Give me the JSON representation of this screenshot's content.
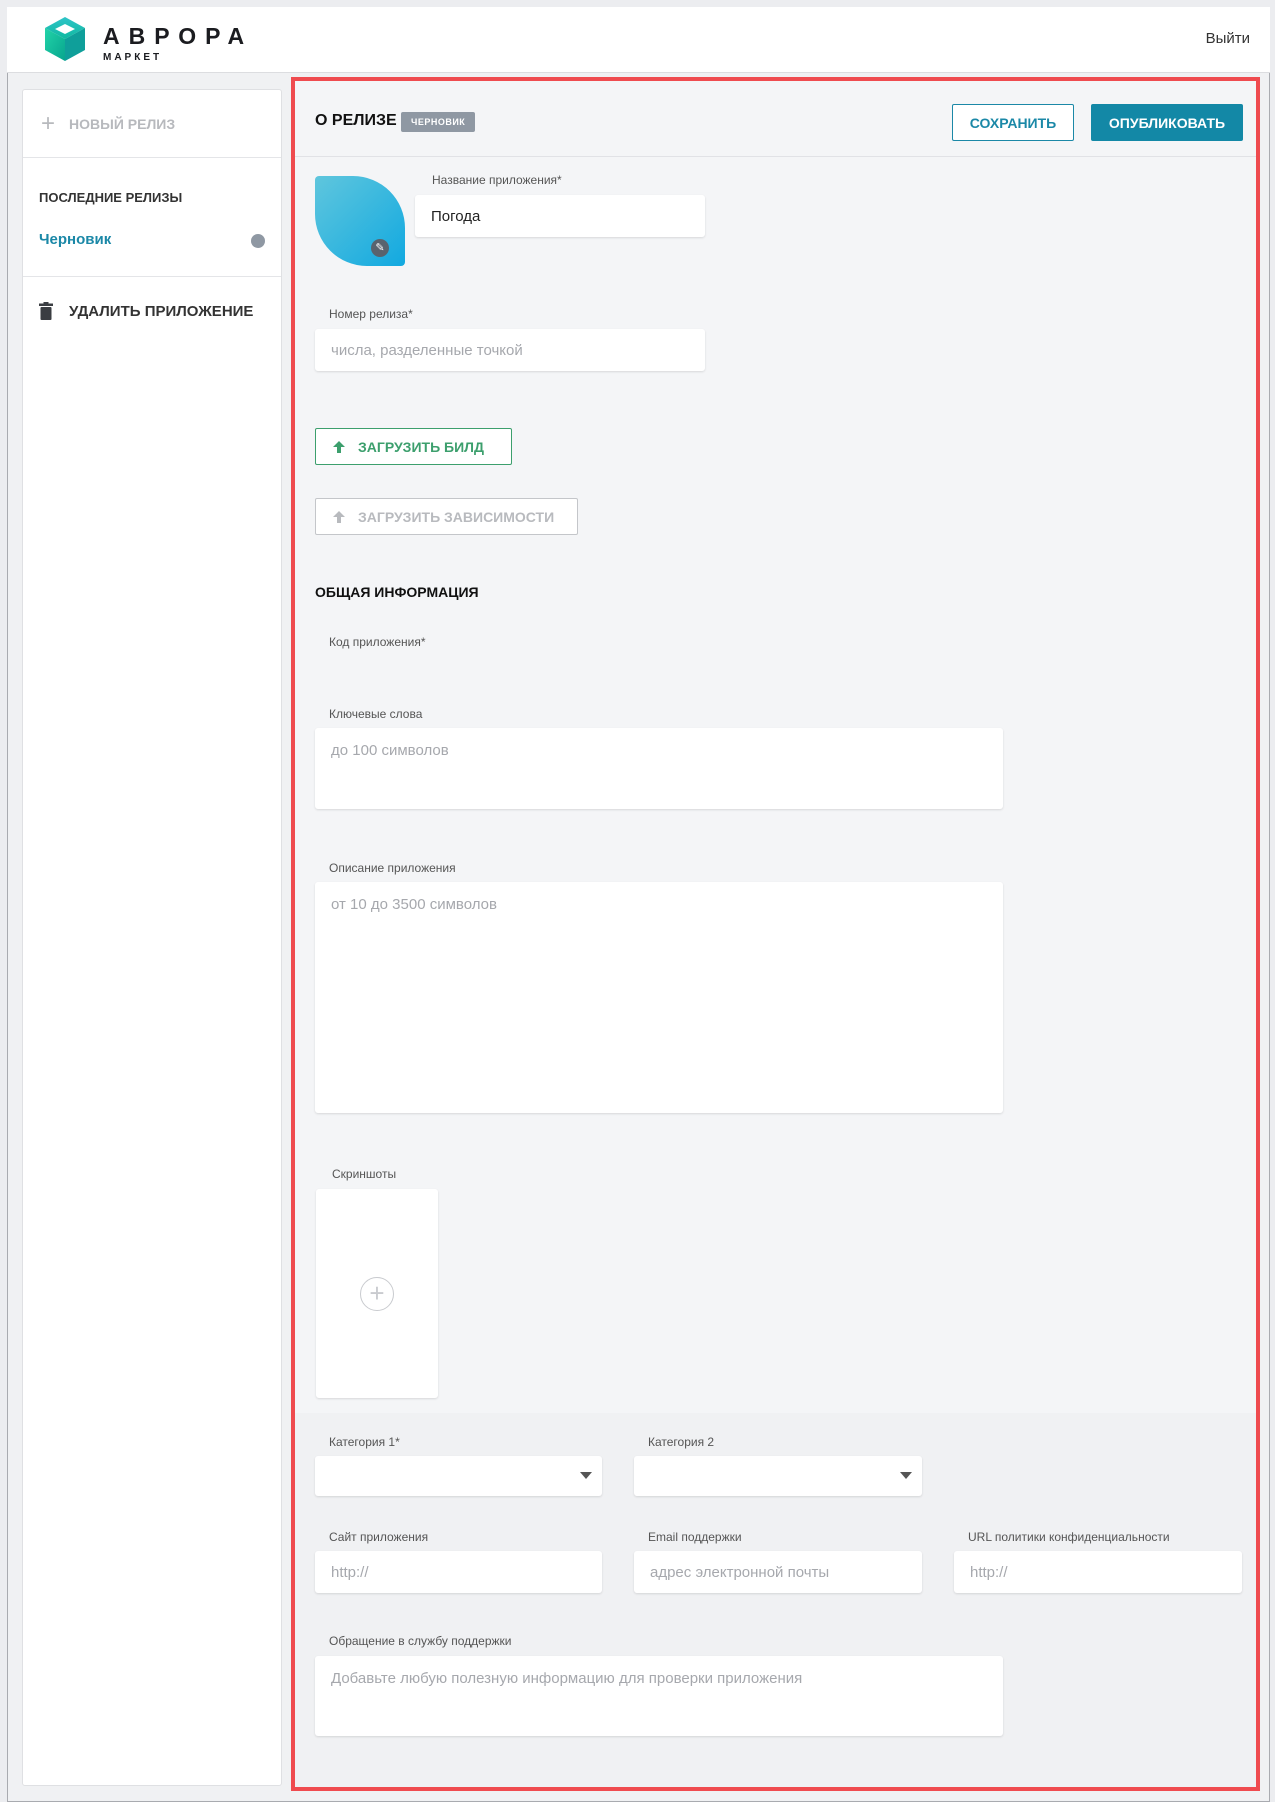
{
  "header": {
    "brand": "АВРОРА",
    "brand_sub": "МАРКЕТ",
    "logout": "Выйти"
  },
  "sidebar": {
    "new_release": "НОВЫЙ РЕЛИЗ",
    "recent_title": "ПОСЛЕДНИЕ РЕЛИЗЫ",
    "draft_item": "Черновик",
    "delete_app": "УДАЛИТЬ ПРИЛОЖЕНИЕ"
  },
  "main": {
    "section_title": "О РЕЛИЗЕ",
    "status_badge": "ЧЕРНОВИК",
    "save_label": "СОХРАНИТЬ",
    "publish_label": "ОПУБЛИКОВАТЬ",
    "app_name_label": "Название приложения*",
    "app_name_value": "Погода",
    "release_number_label": "Номер релиза*",
    "release_number_placeholder": "числа, разделенные точкой",
    "upload_build": "ЗАГРУЗИТЬ БИЛД",
    "upload_deps": "ЗАГРУЗИТЬ ЗАВИСИМОСТИ",
    "general_info_title": "ОБЩАЯ ИНФОРМАЦИЯ",
    "app_code_label": "Код приложения*",
    "keywords_label": "Ключевые слова",
    "keywords_placeholder": "до 100 символов",
    "description_label": "Описание приложения",
    "description_placeholder": "от 10 до 3500 символов",
    "screenshots_label": "Скриншоты",
    "category1_label": "Категория 1*",
    "category2_label": "Категория 2",
    "site_label": "Сайт приложения",
    "site_placeholder": "http://",
    "email_label": "Email поддержки",
    "email_placeholder": "адрес электронной почты",
    "privacy_label": "URL политики конфиденциальности",
    "privacy_placeholder": "http://",
    "support_label": "Обращение в службу поддержки",
    "support_placeholder": "Добавьте любую полезную информацию для проверки приложения"
  },
  "colors": {
    "accent": "#1388a6",
    "upload_green": "#3c9f6d",
    "highlight_border": "#ef4b4f",
    "badge_gray": "#8f98a3"
  }
}
